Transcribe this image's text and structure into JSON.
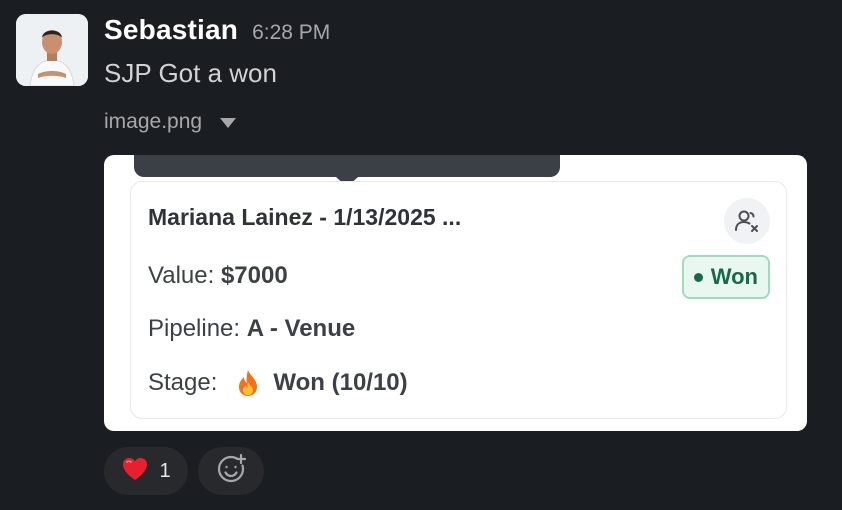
{
  "message": {
    "sender": "Sebastian",
    "timestamp": "6:28 PM",
    "text": "SJP Got a won"
  },
  "attachment": {
    "file_name": "image.png",
    "expand_icon": "chevron-down-icon"
  },
  "deal_card": {
    "title": "Mariana Lainez - 1/13/2025 ...",
    "value_label": "Value:",
    "value": "$7000",
    "pipeline_label": "Pipeline:",
    "pipeline": "A - Venue",
    "stage_label": "Stage:",
    "stage_icon": "flame-icon",
    "stage": "Won (10/10)",
    "status": "Won",
    "status_color": "#17694a",
    "assign_icon": "user-x-icon"
  },
  "reactions": [
    {
      "emoji": "❤️",
      "icon": "heart-icon",
      "count": "1"
    }
  ],
  "add_reaction_icon": "add-emoji-icon",
  "colors": {
    "background": "#1a1d21",
    "sender": "#ffffff",
    "text": "#d1d2d3",
    "muted": "#a7a8aa",
    "badge_border": "#9fdcbf",
    "badge_bg": "#e8f8f0"
  }
}
